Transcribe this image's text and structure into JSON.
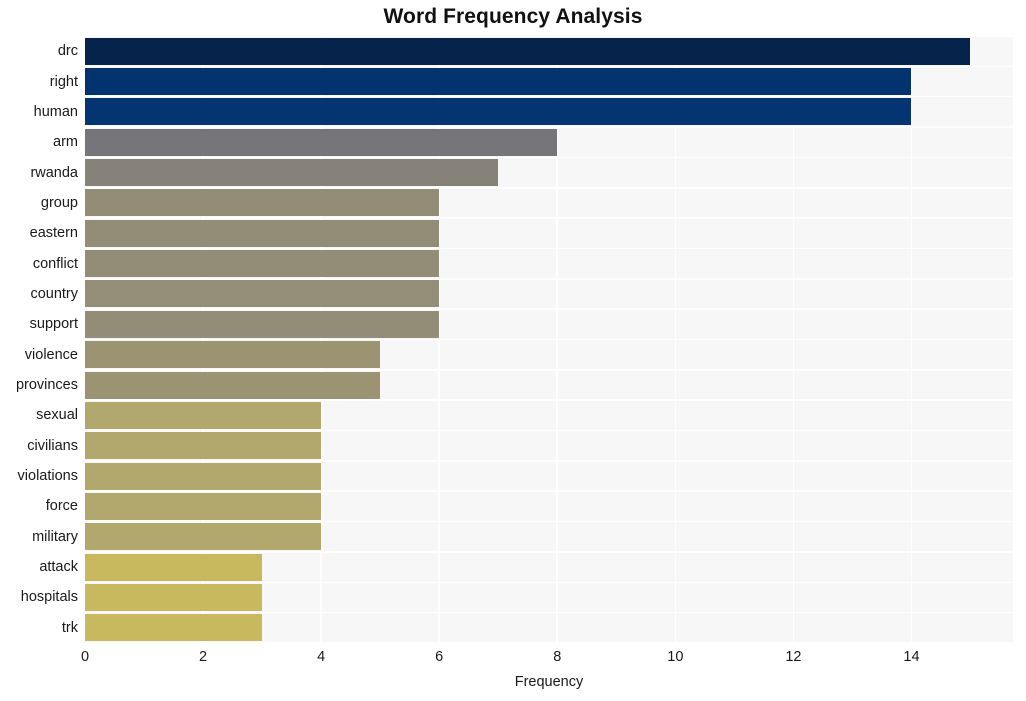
{
  "chart_data": {
    "type": "bar",
    "orientation": "horizontal",
    "title": "Word Frequency Analysis",
    "xlabel": "Frequency",
    "ylabel": "",
    "categories": [
      "drc",
      "right",
      "human",
      "arm",
      "rwanda",
      "group",
      "eastern",
      "conflict",
      "country",
      "support",
      "violence",
      "provinces",
      "sexual",
      "civilians",
      "violations",
      "force",
      "military",
      "attack",
      "hospitals",
      "trk"
    ],
    "values": [
      15,
      14,
      14,
      8,
      7,
      6,
      6,
      6,
      6,
      6,
      5,
      5,
      4,
      4,
      4,
      4,
      4,
      3,
      3,
      3
    ],
    "bar_colors": [
      "#06234b",
      "#03336f",
      "#043471",
      "#76767a",
      "#868179",
      "#938c76",
      "#938c76",
      "#938c76",
      "#948d77",
      "#938c76",
      "#9b9372",
      "#9b9371",
      "#b2a76c",
      "#b2a76c",
      "#b2a76c",
      "#b2a76c",
      "#b2a76c",
      "#c8b95f",
      "#c8b95f",
      "#c8b95f"
    ],
    "xlim": [
      0,
      15.72
    ],
    "xticks": [
      "0",
      "2",
      "4",
      "6",
      "8",
      "10",
      "12",
      "14"
    ],
    "xtick_values": [
      0,
      2,
      4,
      6,
      8,
      10,
      12,
      14
    ],
    "grid": true,
    "grid_color": "#ffffff",
    "plot_background": "#f7f7f7",
    "figure_background": "#ffffff",
    "legend": null
  }
}
